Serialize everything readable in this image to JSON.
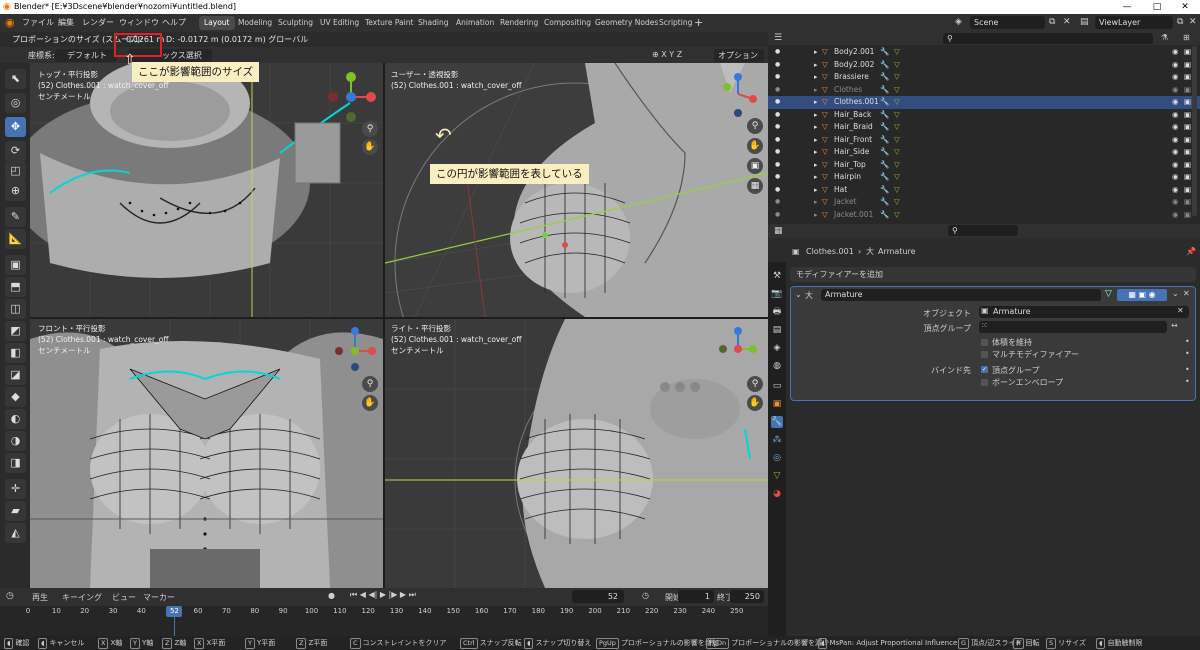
{
  "titlebar": {
    "title": "Blender* [E:¥3Dscene¥blender¥nozomi¥untitled.blend]",
    "minimize": "—",
    "maximize": "□",
    "close": "✕"
  },
  "menu": [
    "ファイル",
    "編集",
    "レンダー",
    "ウィンドウ",
    "ヘルプ"
  ],
  "workspaces": [
    "Layout",
    "Modeling",
    "Sculpting",
    "UV Editing",
    "Texture Paint",
    "Shading",
    "Animation",
    "Rendering",
    "Compositing",
    "Geometry Nodes",
    "Scripting"
  ],
  "workspace_active": "Layout",
  "scene": "Scene",
  "view_layer": "ViewLayer",
  "status_header": {
    "prefix": "プロポーションのサイズ (スムーズ):",
    "size_value": "0.1261 m",
    "rest": "D: -0.0172 m (0.0172 m) グローバル"
  },
  "view_header": {
    "coord_label": "座標系:",
    "coord_value": "デフォルト",
    "select_box": "ックス選択",
    "options": "オプション"
  },
  "callouts": {
    "size_note": "ここが影響範囲のサイズ",
    "circle_note": "この円が影響範囲を表している"
  },
  "viewports": [
    {
      "name": "トップ・平行投影",
      "object": "(52) Clothes.001 : watch_cover_off",
      "unit": "センチメートル"
    },
    {
      "name": "ユーザー・透視投影",
      "object": "(52) Clothes.001 : watch_cover_off",
      "unit": ""
    },
    {
      "name": "フロント・平行投影",
      "object": "(52) Clothes.001 : watch_cover_off",
      "unit": "センチメートル"
    },
    {
      "name": "ライト・平行投影",
      "object": "(52) Clothes.001 : watch_cover_off",
      "unit": "センチメートル"
    }
  ],
  "gizmo": {
    "x": "X",
    "y": "Y",
    "z": "Z"
  },
  "outliner": {
    "items": [
      {
        "name": "Body2.001",
        "dim": false,
        "selected": false
      },
      {
        "name": "Body2.002",
        "dim": false,
        "selected": false
      },
      {
        "name": "Brassiere",
        "dim": false,
        "selected": false
      },
      {
        "name": "Clothes",
        "dim": true,
        "selected": false
      },
      {
        "name": "Clothes.001",
        "dim": false,
        "selected": true
      },
      {
        "name": "Hair_Back",
        "dim": false,
        "selected": false
      },
      {
        "name": "Hair_Braid",
        "dim": false,
        "selected": false
      },
      {
        "name": "Hair_Front",
        "dim": false,
        "selected": false
      },
      {
        "name": "Hair_Side",
        "dim": false,
        "selected": false
      },
      {
        "name": "Hair_Top",
        "dim": false,
        "selected": false
      },
      {
        "name": "Hairpin",
        "dim": false,
        "selected": false
      },
      {
        "name": "Hat",
        "dim": false,
        "selected": false
      },
      {
        "name": "Jacket",
        "dim": true,
        "selected": false
      },
      {
        "name": "Jacket.001",
        "dim": true,
        "selected": false
      }
    ]
  },
  "properties": {
    "breadcrumb_object": "Clothes.001",
    "breadcrumb_modifier": "Armature",
    "add_modifier": "モディファイアーを追加",
    "modifier_name": "Armature",
    "object_label": "オブジェクト",
    "object_value": "Armature",
    "vgroup_label": "頂点グループ",
    "preserve_volume": "体積を維持",
    "multi_modifier": "マルチモディファイアー",
    "bind_label": "バインド先",
    "bind_vgroups": "頂点グループ",
    "bind_envelope": "ボーンエンベロープ"
  },
  "timeline": {
    "menus": [
      "再生",
      "キーイング",
      "ビュー",
      "マーカー"
    ],
    "current_frame": "52",
    "start_label": "開始",
    "start_value": "1",
    "end_label": "終了",
    "end_value": "250",
    "ticks": [
      "0",
      "10",
      "20",
      "30",
      "40",
      "50",
      "60",
      "70",
      "80",
      "90",
      "100",
      "110",
      "120",
      "130",
      "140",
      "150",
      "160",
      "170",
      "180",
      "190",
      "200",
      "210",
      "220",
      "230",
      "240",
      "250"
    ]
  },
  "statusbar": {
    "items": [
      {
        "key": "",
        "label": "確認"
      },
      {
        "key": "",
        "label": "キャンセル"
      },
      {
        "key": "X",
        "label": "X軸"
      },
      {
        "key": "Y",
        "label": "Y軸"
      },
      {
        "key": "Z",
        "label": "Z軸"
      },
      {
        "key": "X",
        "label": "X平面"
      },
      {
        "key": "Y",
        "label": "Y平面"
      },
      {
        "key": "Z",
        "label": "Z平面"
      },
      {
        "key": "C",
        "label": "コンストレイントをクリア"
      },
      {
        "key": "Ctrl",
        "label": "スナップ反転"
      },
      {
        "key": "",
        "label": "スナップ切り替え"
      },
      {
        "key": "PgUp",
        "label": "プロポーショナルの影響を増加"
      },
      {
        "key": "PgDn",
        "label": "プロポーショナルの影響を減少"
      },
      {
        "key": "",
        "label": "MsPan: Adjust Proportional Influence"
      },
      {
        "key": "G",
        "label": "頂点/辺スライド"
      },
      {
        "key": "R",
        "label": "回転"
      },
      {
        "key": "S",
        "label": "リサイズ"
      },
      {
        "key": "",
        "label": "自動触制限"
      }
    ]
  },
  "colors": {
    "accent": "#4772b3",
    "callout_bg": "#fbeec1",
    "highlight_box": "#e0202a",
    "cyan_edge": "#00d7d7",
    "axis_x": "#e04a4a",
    "axis_y": "#7fbf2a",
    "axis_z": "#3a78d8"
  }
}
